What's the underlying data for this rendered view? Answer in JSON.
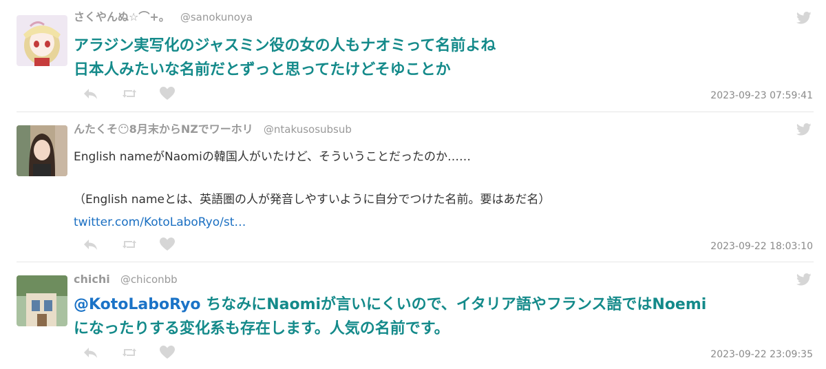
{
  "tweets": [
    {
      "name": "さくやんぬ☆⌒+。",
      "handle": "@sanokunoya",
      "line1": "アラジン実写化のジャスミン役の女の人もナオミって名前よね",
      "line2": "日本人みたいな名前だとずっと思ってたけどそゆことか",
      "time": "2023-09-23 07:59:41"
    },
    {
      "name": "んたくそ😶8月末からNZでワーホリ",
      "handle": "@ntakusosubsub",
      "line1": "English nameがNaomiの韓国人がいたけど、そういうことだったのか……",
      "line2": "（English nameとは、英語圏の人が発音しやすいように自分でつけた名前。要はあだ名）",
      "link": "twitter.com/KotoLaboRyo/st…",
      "time": "2023-09-22 18:03:10"
    },
    {
      "name": "chichi",
      "handle": "@chiconbb",
      "mention": "@KotoLaboRyo",
      "line1": " ちなみにNaomiが言いにくいので、イタリア語やフランス語ではNoemi",
      "line2": "になったりする変化系も存在します。人気の名前です。",
      "time": "2023-09-22 23:09:35"
    }
  ],
  "colors": {
    "highlight_text": "#148a8a",
    "mention": "#1b73c7",
    "link": "#1a6fc2",
    "muted": "#999999",
    "icon": "#d6d6d6"
  },
  "icons": [
    "twitter-bird-icon",
    "reply-icon",
    "retweet-icon",
    "like-icon"
  ]
}
